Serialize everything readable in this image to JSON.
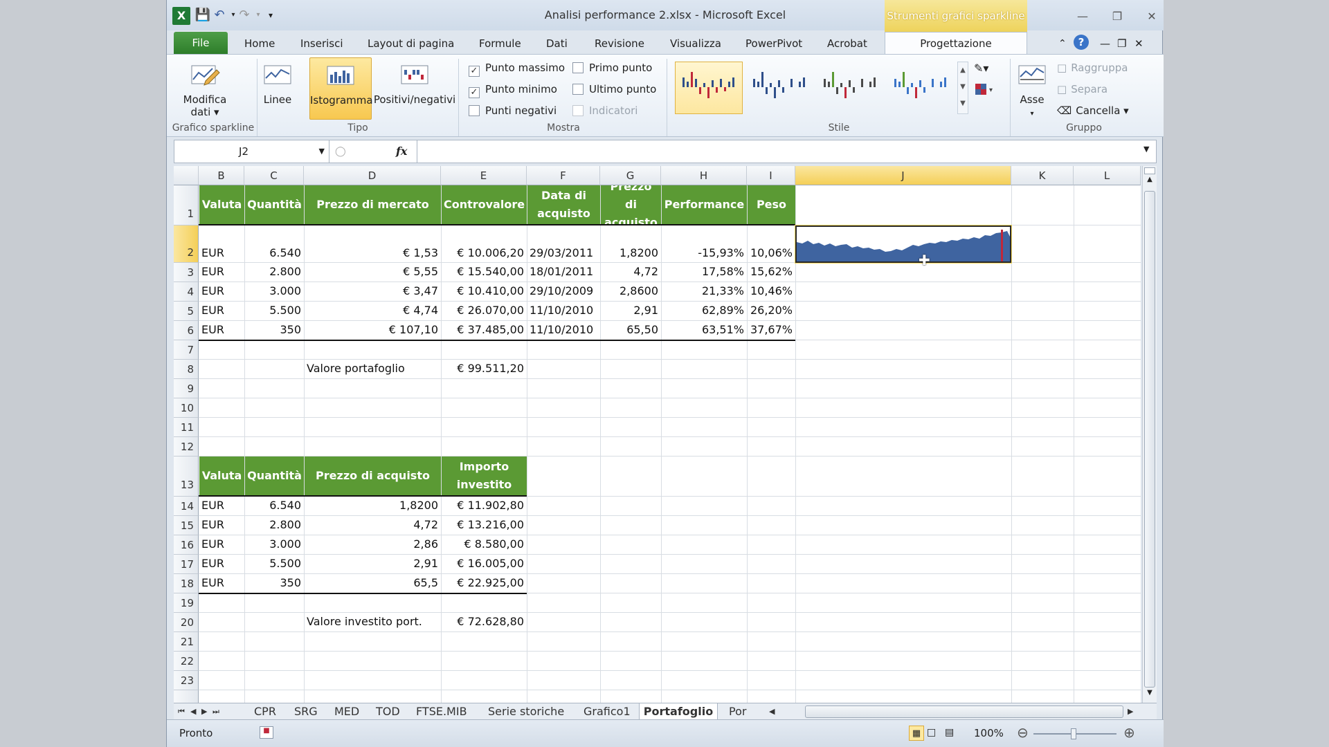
{
  "title": "Analisi performance 2.xlsx - Microsoft Excel",
  "context_tab_header": "Strumenti grafici sparkline",
  "tabs": {
    "file": "File",
    "items": [
      "Home",
      "Inserisci",
      "Layout di pagina",
      "Formule",
      "Dati",
      "Revisione",
      "Visualizza",
      "PowerPivot",
      "Acrobat"
    ],
    "active": "Progettazione"
  },
  "ribbon": {
    "modifica": "Modifica dati ▾",
    "linee": "Linee",
    "istogramma": "Istogramma",
    "posneg": "Positivi/negativi",
    "checks": [
      {
        "label": "Punto massimo",
        "checked": "✓"
      },
      {
        "label": "Primo punto",
        "checked": ""
      },
      {
        "label": "Punto minimo",
        "checked": "✓"
      },
      {
        "label": "Ultimo punto",
        "checked": ""
      },
      {
        "label": "Punti negativi",
        "checked": ""
      },
      {
        "label": "Indicatori",
        "checked": ""
      }
    ],
    "asse": "Asse",
    "raggruppa": "Raggruppa",
    "separa": "Separa",
    "cancella": "Cancella ▾",
    "groups": {
      "grafico": "Grafico sparkline",
      "tipo": "Tipo",
      "mostra": "Mostra",
      "stile": "Stile",
      "gruppo": "Gruppo"
    }
  },
  "formula_bar": {
    "name_box": "J2",
    "fx": "fx",
    "value": ""
  },
  "columns": [
    "B",
    "C",
    "D",
    "E",
    "F",
    "G",
    "H",
    "I",
    "J",
    "K",
    "L"
  ],
  "rows": [
    "1",
    "2",
    "3",
    "4",
    "5",
    "6",
    "7",
    "8",
    "9",
    "10",
    "11",
    "12",
    "13",
    "14",
    "15",
    "16",
    "17",
    "18",
    "19",
    "20",
    "21",
    "22",
    "23"
  ],
  "table1": {
    "headers": [
      "Valuta",
      "Quantità",
      "Prezzo di mercato",
      "Controvalore",
      "Data di acquisto",
      "Prezzo di acquisto",
      "Performance",
      "Peso"
    ],
    "rows": [
      [
        "EUR",
        "6.540",
        "€ 1,53",
        "€ 10.006,20",
        "29/03/2011",
        "1,8200",
        "-15,93%",
        "10,06%"
      ],
      [
        "EUR",
        "2.800",
        "€ 5,55",
        "€ 15.540,00",
        "18/01/2011",
        "4,72",
        "17,58%",
        "15,62%"
      ],
      [
        "EUR",
        "3.000",
        "€ 3,47",
        "€ 10.410,00",
        "29/10/2009",
        "2,8600",
        "21,33%",
        "10,46%"
      ],
      [
        "EUR",
        "5.500",
        "€ 4,74",
        "€ 26.070,00",
        "11/10/2010",
        "2,91",
        "62,89%",
        "26,20%"
      ],
      [
        "EUR",
        "350",
        "€ 107,10",
        "€ 37.485,00",
        "11/10/2010",
        "65,50",
        "63,51%",
        "37,67%"
      ]
    ]
  },
  "valore_portafoglio": {
    "label": "Valore portafoglio",
    "value": "€ 99.511,20"
  },
  "table2": {
    "headers": [
      "Valuta",
      "Quantità",
      "Prezzo di acquisto",
      "Importo investito"
    ],
    "rows": [
      [
        "EUR",
        "6.540",
        "1,8200",
        "€ 11.902,80"
      ],
      [
        "EUR",
        "2.800",
        "4,72",
        "€ 13.216,00"
      ],
      [
        "EUR",
        "3.000",
        "2,86",
        "€ 8.580,00"
      ],
      [
        "EUR",
        "5.500",
        "2,91",
        "€ 16.005,00"
      ],
      [
        "EUR",
        "350",
        "65,5",
        "€ 22.925,00"
      ]
    ]
  },
  "valore_investito": {
    "label": "Valore investito port.",
    "value": "€ 72.628,80"
  },
  "sheet_tabs": [
    "CPR",
    "SRG",
    "MED",
    "TOD",
    "FTSE.MIB",
    "Serie storiche",
    "Grafico1",
    "Portafoglio",
    "Por"
  ],
  "active_sheet": "Portafoglio",
  "status": {
    "ready": "Pronto",
    "zoom": "100%"
  },
  "colors": {
    "header_green": "#5b9a34",
    "sparkline": "#3f64a0",
    "sparkline_max": "#c0283a",
    "selected": "#f6d95e"
  }
}
